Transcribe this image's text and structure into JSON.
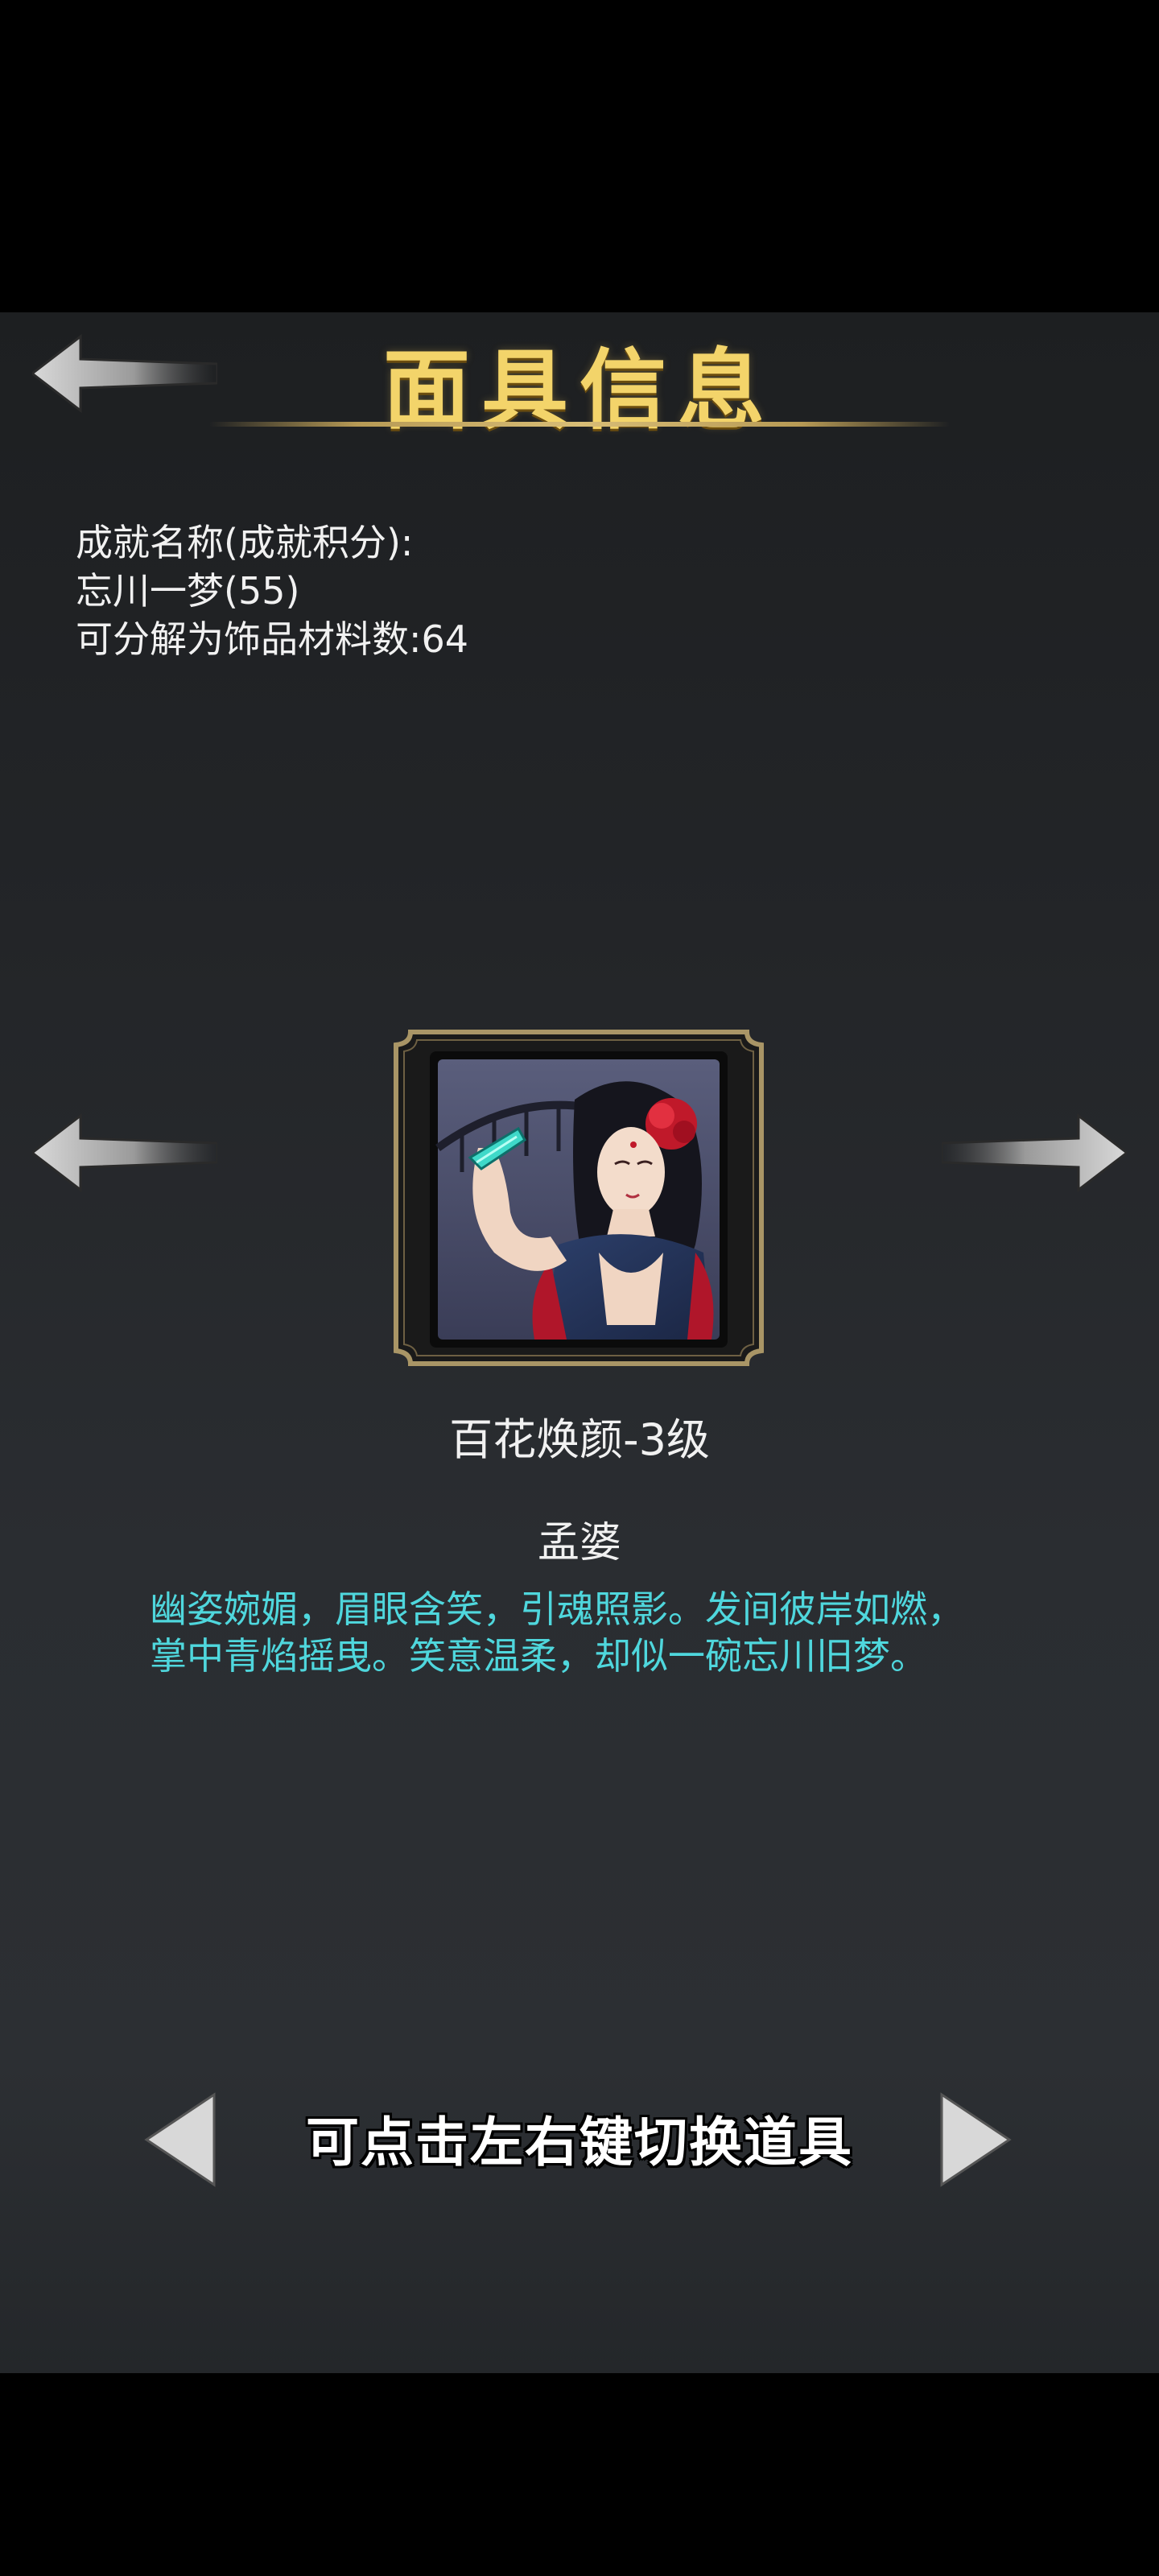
{
  "header": {
    "title": "面具信息",
    "back_icon": "back-arrow-icon"
  },
  "info": {
    "achievement_label": "成就名称(成就积分):",
    "achievement_value": "忘川一梦(55)",
    "decompose_text": "可分解为饰品材料数:64"
  },
  "item": {
    "name": "百花焕颜-3级",
    "character": "孟婆",
    "description_lines": [
      "幽姿婉媚，眉眼含笑，引魂照影。发间彼岸如燃，",
      "掌中青焰摇曳。笑意温柔，却似一碗忘川旧梦。"
    ]
  },
  "footer": {
    "hint": "可点击左右键切换道具"
  },
  "colors": {
    "title": "#f3d46a",
    "description": "#4fd7dd",
    "frame_gold": "#a99566"
  }
}
